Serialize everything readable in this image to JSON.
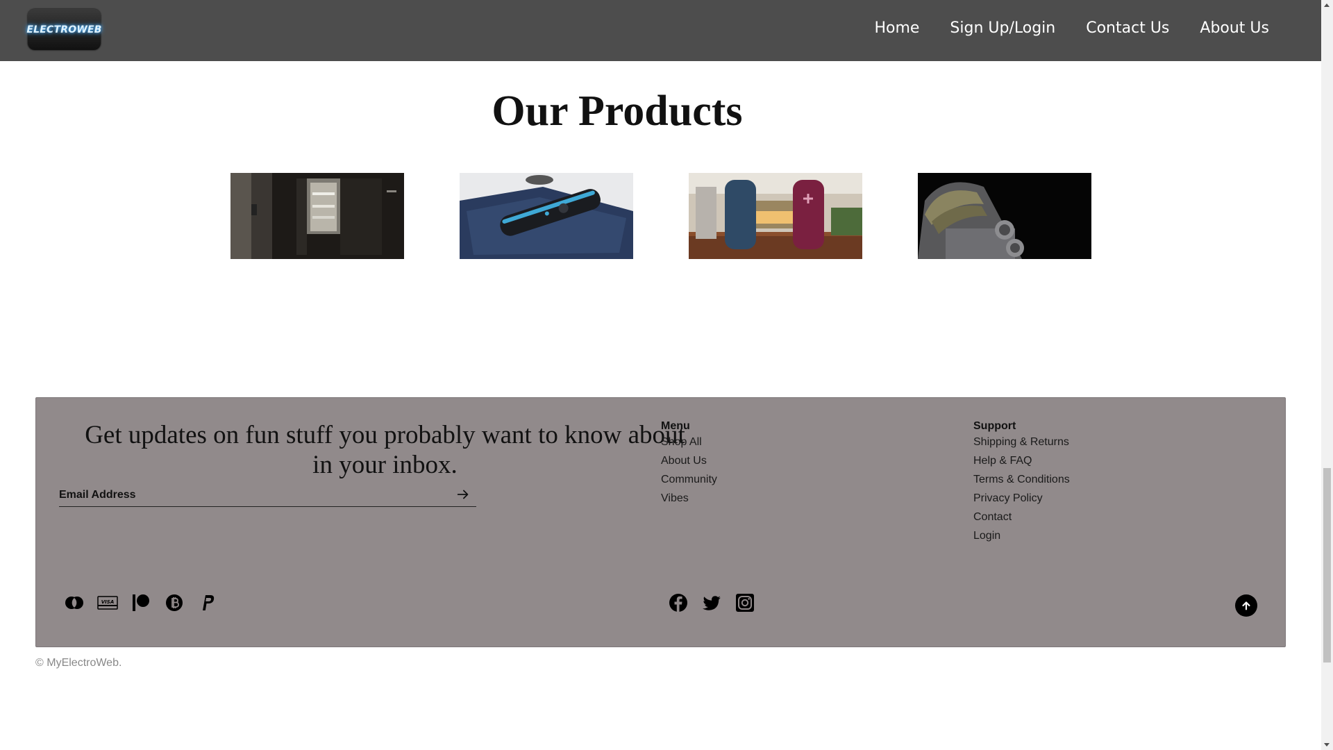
{
  "header": {
    "logo_text": "ELECTROWEB",
    "nav": [
      {
        "label": "Home"
      },
      {
        "label": "Sign Up/Login"
      },
      {
        "label": "Contact Us"
      },
      {
        "label": "About Us"
      }
    ]
  },
  "products": {
    "title": "Our Products",
    "items": [
      {
        "image": "refrigerator-photo"
      },
      {
        "image": "trimmer-photo"
      },
      {
        "image": "speakers-photo"
      },
      {
        "image": "microphone-photo"
      }
    ]
  },
  "footer": {
    "newsletter_title": "Get updates on fun stuff you probably want to know about in your inbox.",
    "email_placeholder": "Email Address",
    "menu": {
      "heading": "Menu",
      "items": [
        "Shop All",
        "About Us",
        "Community",
        "Vibes"
      ]
    },
    "support": {
      "heading": "Support",
      "items": [
        "Shipping & Returns",
        "Help & FAQ",
        "Terms & Conditions",
        "Privacy Policy",
        "Contact",
        "Login"
      ]
    },
    "payment_icons": [
      "mastercard-icon",
      "visa-icon",
      "patreon-icon",
      "bitcoin-icon",
      "paypal-icon"
    ],
    "payment_visa_text": "VISA",
    "social_icons": [
      "facebook-icon",
      "twitter-icon",
      "instagram-icon"
    ],
    "copyright": "© MyElectroWeb."
  },
  "colors": {
    "header_bg": "#4d4d4d",
    "footer_bg": "#918a8b"
  }
}
